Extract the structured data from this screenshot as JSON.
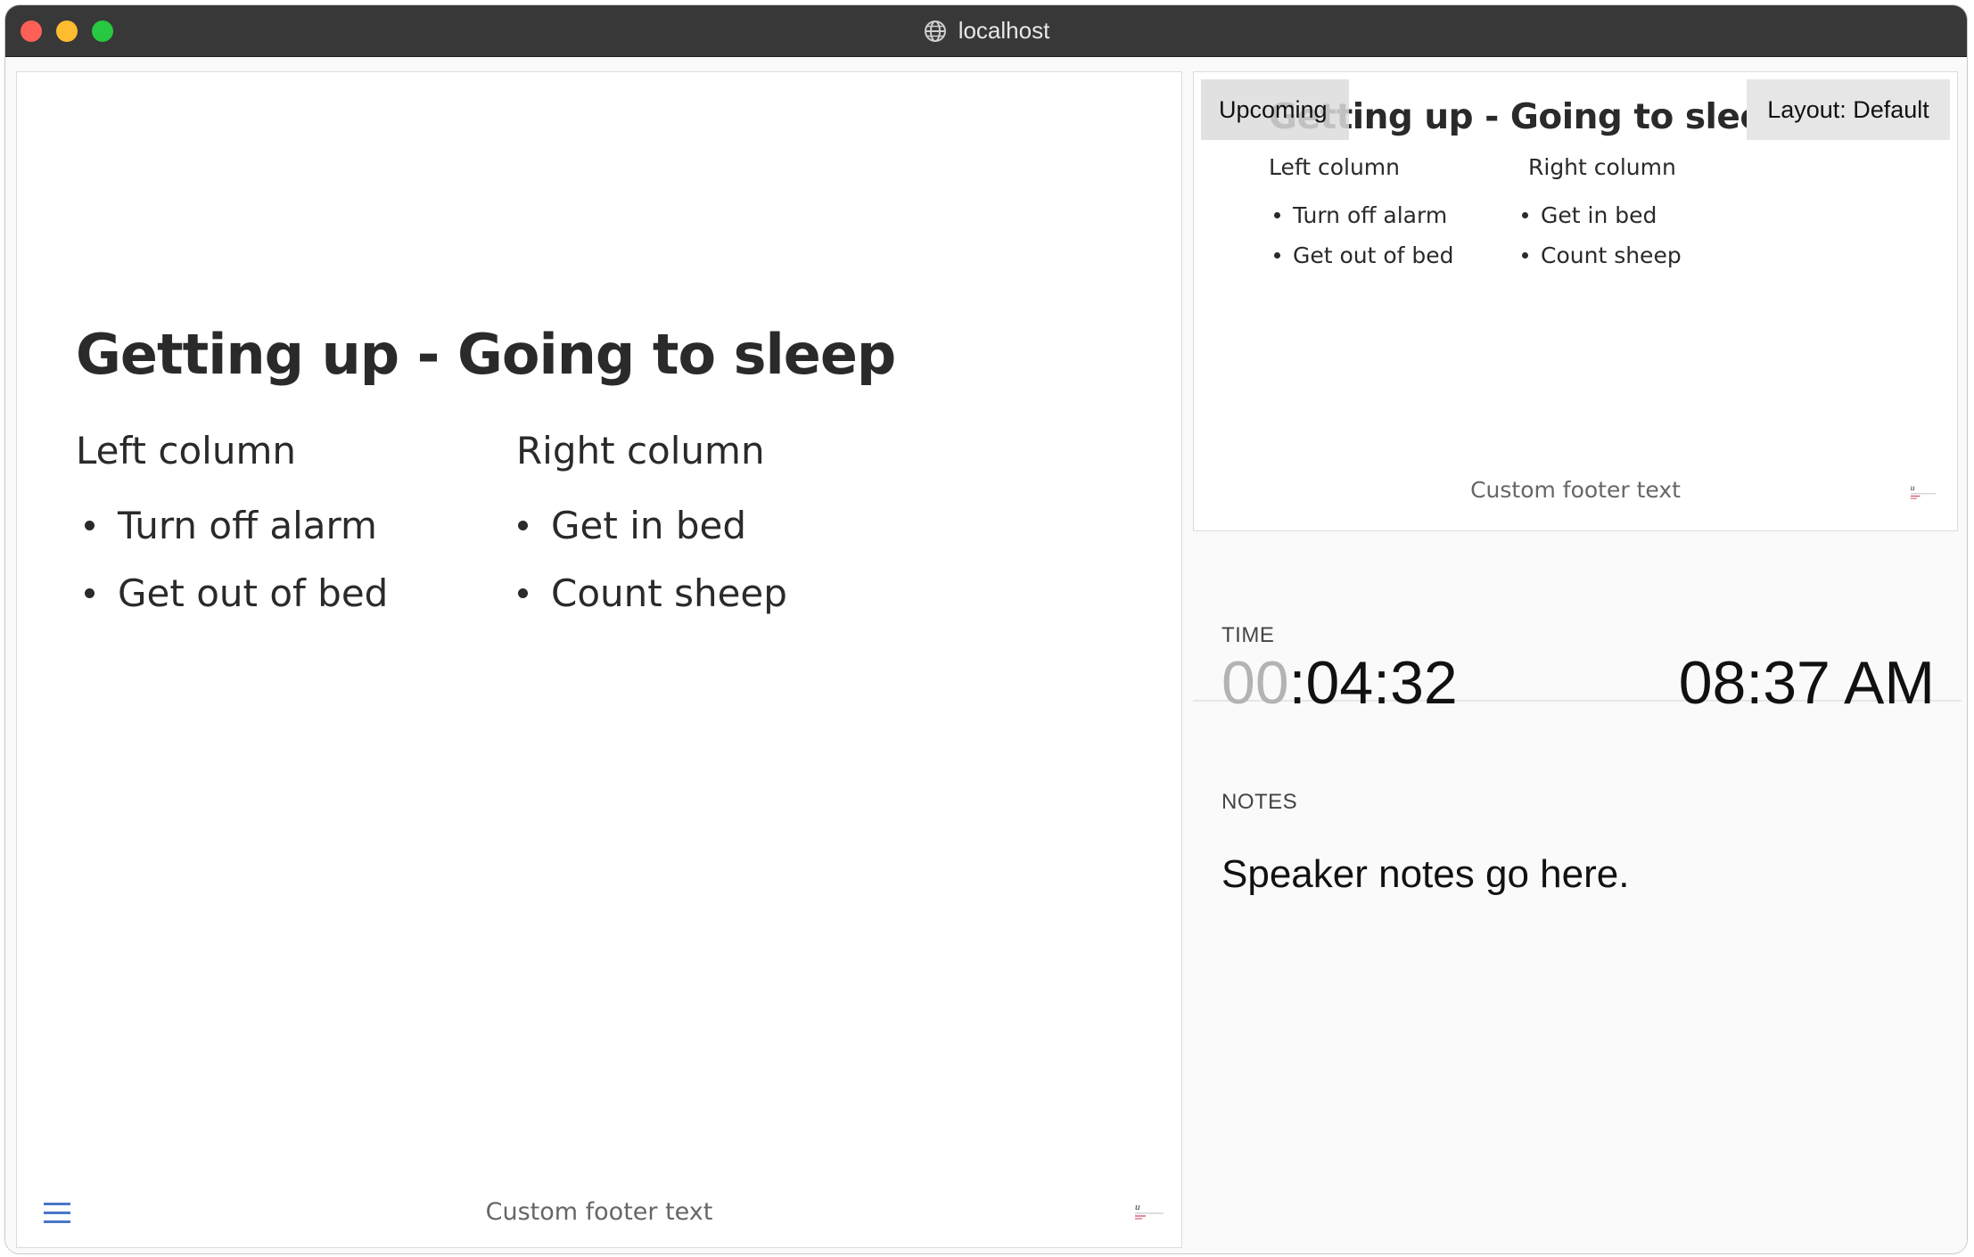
{
  "window": {
    "title": "localhost",
    "icon": "globe-icon"
  },
  "slide": {
    "title": "Getting up - Going to sleep",
    "left_column": {
      "heading": "Left column",
      "items": [
        "Turn off alarm",
        "Get out of bed"
      ]
    },
    "right_column": {
      "heading": "Right column",
      "items": [
        "Get in bed",
        "Count sheep"
      ]
    },
    "footer": "Custom footer text",
    "menu_icon": "hamburger-menu-icon",
    "logo_icon": "logo-mark-icon"
  },
  "preview": {
    "upcoming_label": "Upcoming",
    "layout_label": "Layout: Default",
    "title": "Getting up - Going to sleep",
    "left_column": {
      "heading": "Left column",
      "items": [
        "Turn off alarm",
        "Get out of bed"
      ]
    },
    "right_column": {
      "heading": "Right column",
      "items": [
        "Get in bed",
        "Count sheep"
      ]
    },
    "footer": "Custom footer text"
  },
  "time": {
    "label": "TIME",
    "timer_hours": "00",
    "timer_rest": ":04:32",
    "clock": "08:37 AM"
  },
  "notes": {
    "label": "NOTES",
    "text": "Speaker notes go here."
  },
  "colors": {
    "titlebar": "#383838",
    "accent_menu": "#4a76c8",
    "timer_dim": "#b3b3b3"
  }
}
